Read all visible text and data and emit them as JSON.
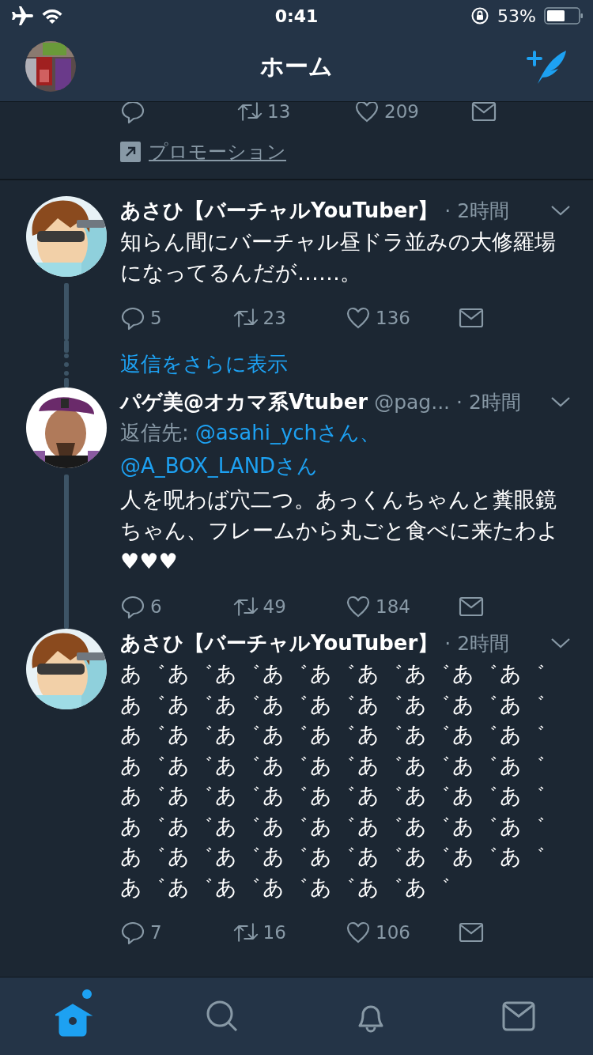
{
  "status_bar": {
    "time": "0:41",
    "battery": "53%"
  },
  "nav": {
    "title": "ホーム"
  },
  "promoted_tail": {
    "retweets": "13",
    "likes": "209",
    "promotion": "プロモーション"
  },
  "tweets": [
    {
      "name": "あさひ【バーチャルYouTuber】",
      "time": "· 2時間",
      "text": "知らん間にバーチャル昼ドラ並みの大修羅場になってるんだが……。",
      "replies": "5",
      "retweets": "23",
      "likes": "136",
      "thread_line": true,
      "show_more": "返信をさらに表示"
    },
    {
      "name": "パゲ美@オカマ系Vtuber",
      "handle": "@pag...",
      "time": "· 2時間",
      "reply_to": {
        "label": "返信先:",
        "users": [
          "@asahi_ychさん、",
          "@A_BOX_LANDさん"
        ]
      },
      "text": "人を呪わば穴二つ。あっくんちゃんと糞眼鏡ちゃん、フレームから丸ごと食べに来たわよ♥♥♥",
      "replies": "6",
      "retweets": "49",
      "likes": "184",
      "thread_line": true
    },
    {
      "name": "あさひ【バーチャルYouTuber】",
      "time": "· 2時間",
      "text": "あ゛あ゛あ゛あ゛あ゛あ゛あ゛あ゛あ゛あ゛あ゛あ゛あ゛あ゛あ゛あ゛あ゛あ゛あ゛あ゛あ゛あ゛あ゛あ゛あ゛あ゛あ゛あ゛あ゛あ゛あ゛あ゛あ゛あ゛あ゛あ゛あ゛あ゛あ゛あ゛あ゛あ゛あ゛あ゛あ゛あ゛あ゛あ゛あ゛あ゛あ゛あ゛あ゛あ゛あ゛あ゛あ゛あ゛あ゛あ゛あ゛あ゛あ゛あ゛あ゛あ゛あ゛あ゛あ゛あ゛",
      "replies": "7",
      "retweets": "16",
      "likes": "106",
      "thread_line": false,
      "spaced": true
    }
  ],
  "tab_bar": [
    {
      "kind": "home",
      "selected": true,
      "badge": true
    },
    {
      "kind": "search",
      "selected": false,
      "badge": false
    },
    {
      "kind": "notifications",
      "selected": false,
      "badge": false
    },
    {
      "kind": "messages",
      "selected": false,
      "badge": false
    }
  ]
}
